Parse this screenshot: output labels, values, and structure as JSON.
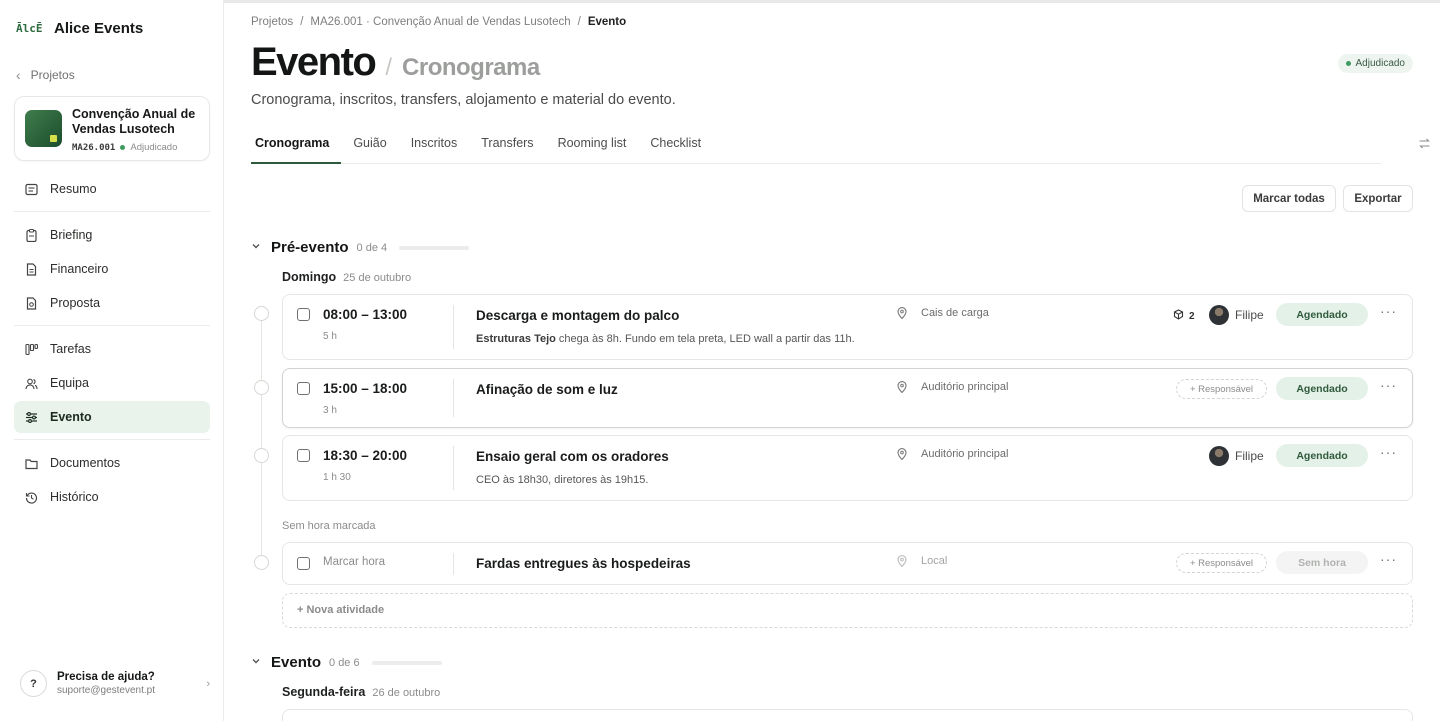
{
  "app": {
    "logo_text": "ĀlcĒ",
    "name": "Alice Events"
  },
  "sidebar": {
    "back_label": "Projetos",
    "project": {
      "title": "Convenção Anual de Vendas Lusotech",
      "code": "MA26.001",
      "status": "Adjudicado"
    },
    "items": [
      {
        "label": "Resumo",
        "icon": "summary-icon"
      },
      {
        "label": "Briefing",
        "icon": "clipboard-icon"
      },
      {
        "label": "Financeiro",
        "icon": "document-icon"
      },
      {
        "label": "Proposta",
        "icon": "proposal-icon"
      },
      {
        "label": "Tarefas",
        "icon": "kanban-icon"
      },
      {
        "label": "Equipa",
        "icon": "team-icon"
      },
      {
        "label": "Evento",
        "icon": "sliders-icon",
        "active": true
      },
      {
        "label": "Documentos",
        "icon": "folder-icon"
      },
      {
        "label": "Histórico",
        "icon": "history-icon"
      }
    ],
    "help": {
      "icon_text": "?",
      "title": "Precisa de ajuda?",
      "email": "suporte@gestevent.pt"
    }
  },
  "breadcrumb": {
    "root": "Projetos",
    "project": "MA26.001 · Convenção Anual de Vendas Lusotech",
    "current": "Evento"
  },
  "header": {
    "title": "Evento",
    "subtitle": "Cronograma",
    "status": "Adjudicado",
    "description": "Cronograma, inscritos, transfers, alojamento e material do evento."
  },
  "tabs": [
    "Cronograma",
    "Guião",
    "Inscritos",
    "Transfers",
    "Rooming list",
    "Checklist"
  ],
  "toolbar": {
    "mark_all": "Marcar todas",
    "export": "Exportar"
  },
  "sections": {
    "pre": {
      "title": "Pré-evento",
      "count": "0 de 4",
      "progress": 0,
      "day_name": "Domingo",
      "day_date": "25 de outubro"
    },
    "event": {
      "title": "Evento",
      "count": "0 de 6",
      "progress": 0,
      "day_name": "Segunda-feira",
      "day_date": "26 de outubro"
    }
  },
  "activities": [
    {
      "time": "08:00 – 13:00",
      "duration": "5 h",
      "title": "Descarga e montagem do palco",
      "desc_bold": "Estruturas Tejo",
      "desc": " chega às 8h. Fundo em tela preta, LED wall a partir das 11h.",
      "location": "Cais de carga",
      "resources": "2",
      "person": "Filipe",
      "status": "Agendado"
    },
    {
      "time": "15:00 – 18:00",
      "duration": "3 h",
      "title": "Afinação de som e luz",
      "location": "Auditório principal",
      "assign_label": "+ Responsável",
      "status": "Agendado"
    },
    {
      "time": "18:30 – 20:00",
      "duration": "1 h 30",
      "title": "Ensaio geral com os oradores",
      "desc": "CEO às 18h30, diretores às 19h15.",
      "location": "Auditório principal",
      "person": "Filipe",
      "status": "Agendado"
    },
    {
      "time": "Marcar hora",
      "title": "Fardas entregues às hospedeiras",
      "location": "Local",
      "assign_label": "+ Responsável",
      "status": "Sem hora"
    }
  ],
  "no_time_label": "Sem hora marcada",
  "new_activity": "+ Nova atividade",
  "more_label": "···",
  "colors": {
    "accent": "#2d5a3c",
    "status_bg": "#e4f1e8",
    "active_nav_bg": "#e9f2eb"
  }
}
